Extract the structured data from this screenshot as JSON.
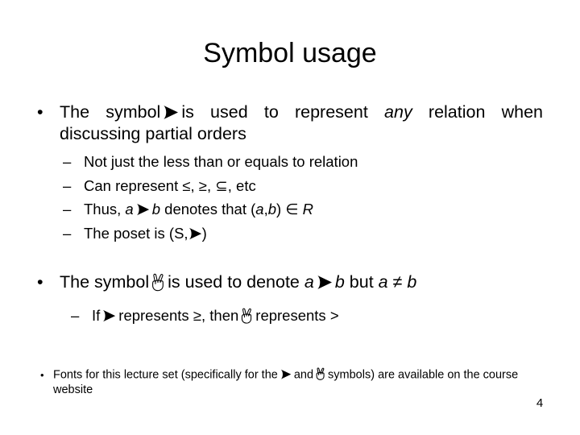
{
  "slide": {
    "title": "Symbol usage",
    "page_number": "4",
    "background_color": "#ffffff",
    "text_color": "#000000"
  },
  "icons": {
    "arrow_symbol_name": "wingdings-arrowhead-icon",
    "hand_symbol_name": "wingdings-victory-hand-icon",
    "bullet_dot": "•",
    "bullet_dash": "–"
  },
  "bullets": {
    "b1": {
      "part1": "The symbol",
      "part2": "is used to represent",
      "emphasis": "any",
      "part3": "relation when discussing partial orders"
    },
    "b1_subs": {
      "s1": "Not just the less than or equals to relation",
      "s2_pre": "Can represent",
      "s2_symbols": "≤, ≥, ⊆,",
      "s2_post": "etc",
      "s3_pre": "Thus,",
      "s3_a": "a",
      "s3_b": "b",
      "s3_mid": "denotes that (",
      "s3_a2": "a",
      "s3_comma": ",",
      "s3_b2": "b",
      "s3_close": ")",
      "s3_in": "∈",
      "s3_R": "R",
      "s4_pre": "The poset is (",
      "s4_S": "S",
      "s4_comma": ",",
      "s4_close": ")"
    },
    "b2": {
      "part1": "The symbol",
      "part2": "is used to denote",
      "a1": "a",
      "b1": "b",
      "mid": "but",
      "a2": "a",
      "neq": "≠",
      "b2": "b"
    },
    "b2_subs": {
      "s5_pre": "If",
      "s5_mid": "represents ≥, then",
      "s5_post": "represents >"
    },
    "note": {
      "part1": "Fonts for this lecture set (specifically for the",
      "part2": "and",
      "part3": "symbols) are available on the course website"
    }
  }
}
